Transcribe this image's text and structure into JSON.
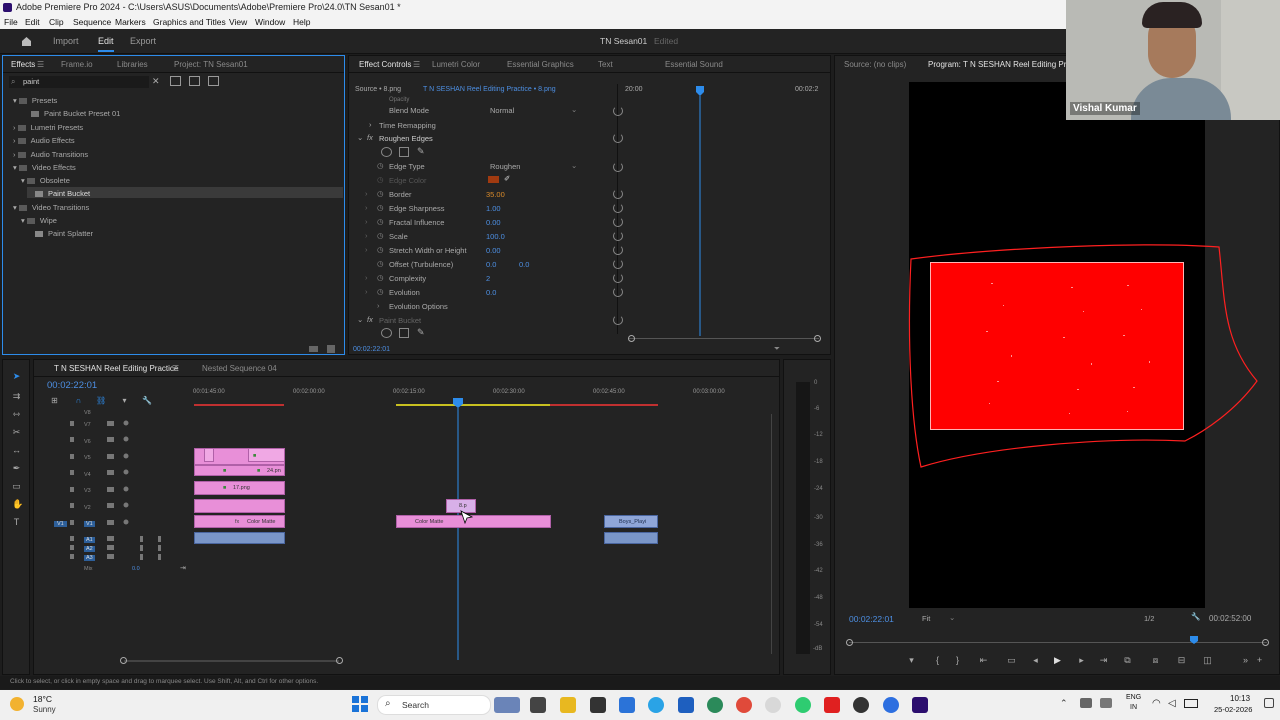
{
  "window": {
    "title": "Adobe Premiere Pro 2024 - C:\\Users\\ASUS\\Documents\\Adobe\\Premiere Pro\\24.0\\TN Sesan01 *"
  },
  "menu": [
    "File",
    "Edit",
    "Clip",
    "Sequence",
    "Markers",
    "Graphics and Titles",
    "View",
    "Window",
    "Help"
  ],
  "topnav": {
    "import": "Import",
    "edit": "Edit",
    "export": "Export",
    "project_name": "TN Sesan01",
    "edited": "Edited"
  },
  "effects_panel": {
    "tabs": [
      "Effects",
      "Frame.io",
      "Libraries",
      "Project: TN Sesan01"
    ],
    "search_value": "paint",
    "tree": [
      "Presets",
      "Paint Bucket Preset 01",
      "Lumetri Presets",
      "Audio Effects",
      "Audio Transitions",
      "Video Effects",
      "Obsolete",
      "Paint Bucket",
      "Video Transitions",
      "Wipe",
      "Paint Splatter"
    ]
  },
  "effect_controls": {
    "tabs": [
      "Effect Controls",
      "Lumetri Color",
      "Essential Graphics",
      "Text",
      "Essential Sound"
    ],
    "source": "Source • 8.png",
    "clip": "T N SESHAN Reel Editing Practice • 8.png",
    "time_start": "20:00",
    "time_end": "00:02:2",
    "rows": {
      "blend_mode": "Blend Mode",
      "blend_mode_val": "Normal",
      "time_remap": "Time Remapping",
      "roughen": "Roughen Edges",
      "edge_type": "Edge Type",
      "edge_type_val": "Roughen",
      "edge_color": "Edge Color",
      "border": "Border",
      "border_val": "35.00",
      "edge_sharp": "Edge Sharpness",
      "edge_sharp_val": "1.00",
      "fractal": "Fractal Influence",
      "fractal_val": "0.00",
      "scale": "Scale",
      "scale_val": "100.0",
      "stretch": "Stretch Width or Height",
      "stretch_val": "0.00",
      "offset": "Offset (Turbulence)",
      "offset_val1": "0.0",
      "offset_val2": "0.0",
      "complexity": "Complexity",
      "complexity_val": "2",
      "evolution": "Evolution",
      "evolution_val": "0.0",
      "evo_options": "Evolution Options",
      "paint_bucket": "Paint Bucket"
    },
    "current_time": "00:02:22:01"
  },
  "source_monitor": {
    "label": "Source: (no clips)"
  },
  "program_monitor": {
    "label": "Program: T N SESHAN Reel Editing Practice",
    "time": "00:02:22:01",
    "fit": "Fit",
    "resolution": "1/2",
    "duration": "00:02:52:00"
  },
  "webcam": {
    "name": "Vishal Kumar"
  },
  "timeline": {
    "tabs": [
      "T N SESHAN Reel Editing Practice",
      "Nested Sequence 04"
    ],
    "timecode": "00:02:22:01",
    "ruler": [
      "00:01:45:00",
      "00:02:00:00",
      "00:02:15:00",
      "00:02:30:00",
      "00:02:45:00",
      "00:03:00:00"
    ],
    "tracks": [
      "V8",
      "V7",
      "V6",
      "V5",
      "V4",
      "V3",
      "V2",
      "V1",
      "A1",
      "A2",
      "A3",
      "Mix"
    ],
    "mix_value": "0.0",
    "clips": {
      "c1": "Color Matte",
      "c2": "Color Matte",
      "c3": "Boys_Playi",
      "c4": "17.png",
      "c5": "24.pn",
      "c6": "fx",
      "c7": "8.p"
    }
  },
  "meters": [
    "0",
    "-6",
    "-12",
    "-18",
    "-24",
    "-30",
    "-36",
    "-42",
    "-48",
    "-54",
    "-dB"
  ],
  "status": {
    "hint": "Click to select, or click in empty space and drag to marquee select. Use Shift, Alt, and Ctrl for other options."
  },
  "taskbar": {
    "temp": "18°C",
    "weather": "Sunny",
    "search": "Search",
    "lang1": "ENG",
    "lang2": "IN",
    "time": "10:13",
    "date": "25-02-2026"
  },
  "colors": {
    "accent": "#2d8ceb",
    "clip_pink": "#e88fd8",
    "red": "#ff0000"
  }
}
